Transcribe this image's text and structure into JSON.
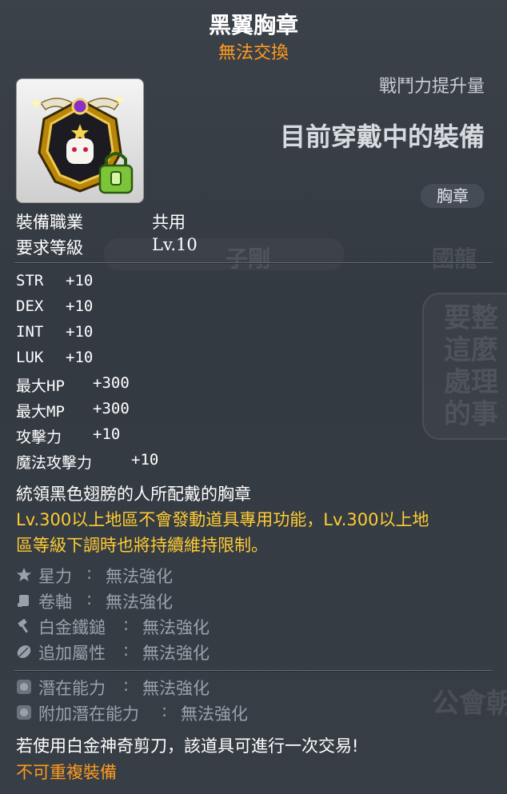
{
  "item": {
    "name": "黑翼胸章",
    "trade_status": "無法交換"
  },
  "combat_power_label": "戰鬥力提升量",
  "equipped_label": "目前穿戴中的裝備",
  "category_badge": "胸章",
  "requirements": {
    "job_label": "裝備職業",
    "job_value": "共用",
    "level_label": "要求等級",
    "level_value": "Lv.10"
  },
  "stats": [
    {
      "name": "STR",
      "value": "+10"
    },
    {
      "name": "DEX",
      "value": "+10"
    },
    {
      "name": "INT",
      "value": "+10"
    },
    {
      "name": "LUK",
      "value": "+10"
    },
    {
      "name": "最大HP",
      "value": "+300"
    },
    {
      "name": "最大MP",
      "value": "+300"
    },
    {
      "name": "攻擊力",
      "value": "+10"
    },
    {
      "name": "魔法攻擊力",
      "value": "+10"
    }
  ],
  "description": "統領黑色翅膀的人所配戴的胸章",
  "warning": {
    "line1": "Lv.300以上地區不會發動道具專用功能，Lv.300以上地",
    "line2": "區等級下調時也將持續維持限制。"
  },
  "enhancements": [
    {
      "label": "星力",
      "status": "無法強化",
      "icon": "star-icon"
    },
    {
      "label": "卷軸",
      "status": "無法強化",
      "icon": "scroll-icon"
    },
    {
      "label": "白金鐵鎚",
      "status": "無法強化",
      "icon": "hammer-icon"
    },
    {
      "label": "追加屬性",
      "status": "無法強化",
      "icon": "leaf-icon"
    }
  ],
  "potentials": [
    {
      "label": "潛在能力",
      "status": "無法強化",
      "icon": "potential-icon"
    },
    {
      "label": "附加潛在能力",
      "status": "無法強化",
      "icon": "additional-potential-icon"
    }
  ],
  "colon": ":",
  "footer": {
    "scissors_note": "若使用白金神奇剪刀，該道具可進行一次交易!",
    "unique_equip": "不可重複裝備"
  },
  "background_text": {
    "sign_left": "子剛",
    "sign_right": "國龍",
    "bubble_lines": [
      "要整",
      "這麼",
      "處理",
      "的事"
    ],
    "bottom_sign": "公會朝"
  },
  "colors": {
    "title": "#ffffff",
    "trade_status": "#ff9a1e",
    "warning": "#ffcc33",
    "disabled": "#9aa1aa",
    "footer_orange": "#ff9a1e"
  }
}
